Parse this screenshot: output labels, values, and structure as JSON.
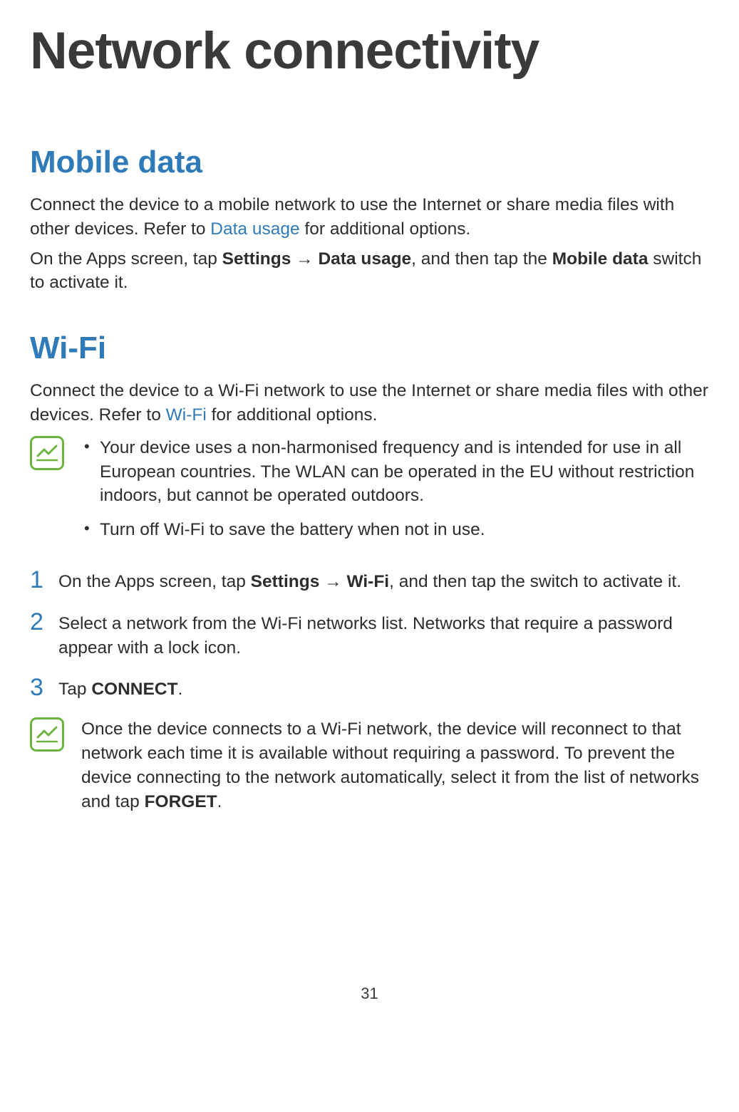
{
  "page_title": "Network connectivity",
  "page_number": "31",
  "sections": {
    "mobile_data": {
      "heading": "Mobile data",
      "p1_pre": "Connect the device to a mobile network to use the Internet or share media files with other devices. Refer to ",
      "p1_link": "Data usage",
      "p1_post": " for additional options.",
      "p2_a": "On the Apps screen, tap ",
      "p2_b": "Settings",
      "p2_arrow": " → ",
      "p2_c": "Data usage",
      "p2_d": ", and then tap the ",
      "p2_e": "Mobile data",
      "p2_f": " switch to activate it."
    },
    "wifi": {
      "heading": "Wi-Fi",
      "p1_pre": "Connect the device to a Wi-Fi network to use the Internet or share media files with other devices. Refer to ",
      "p1_link": "Wi-Fi",
      "p1_post": " for additional options.",
      "note1_b1": "Your device uses a non-harmonised frequency and is intended for use in all European countries. The WLAN can be operated in the EU without restriction indoors, but cannot be operated outdoors.",
      "note1_b2": "Turn off Wi-Fi to save the battery when not in use.",
      "step1_num": "1",
      "step1_a": "On the Apps screen, tap ",
      "step1_b": "Settings",
      "step1_arrow": " → ",
      "step1_c": "Wi-Fi",
      "step1_d": ", and then tap the switch to activate it.",
      "step2_num": "2",
      "step2_text": "Select a network from the Wi-Fi networks list. Networks that require a password appear with a lock icon.",
      "step3_num": "3",
      "step3_a": "Tap ",
      "step3_b": "CONNECT",
      "step3_c": ".",
      "note2_a": "Once the device connects to a Wi-Fi network, the device will reconnect to that network each time it is available without requiring a password. To prevent the device connecting to the network automatically, select it from the list of networks and tap ",
      "note2_b": "FORGET",
      "note2_c": "."
    }
  }
}
